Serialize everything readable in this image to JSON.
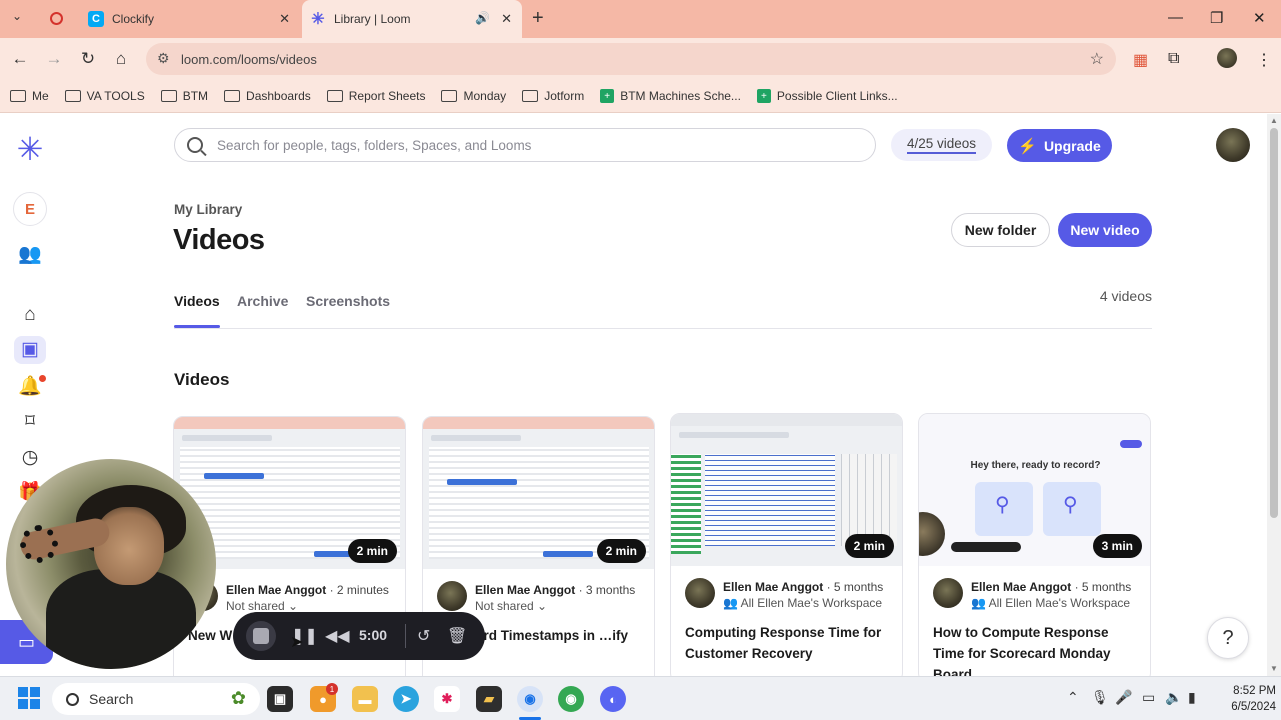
{
  "browser": {
    "tabs": [
      {
        "title": "Clockify",
        "active": false
      },
      {
        "title": "Library | Loom",
        "active": true
      }
    ],
    "url": "loom.com/looms/videos",
    "bookmarks": [
      "Me",
      "VA TOOLS",
      "BTM",
      "Dashboards",
      "Report Sheets",
      "Monday",
      "Jotform",
      "BTM Machines Sche...",
      "Possible Client Links..."
    ]
  },
  "sidebar": {
    "workspace_letter": "E"
  },
  "header": {
    "search_placeholder": "Search for people, tags, folders, Spaces, and Looms",
    "quota": "4/25 videos",
    "upgrade_label": "Upgrade"
  },
  "library": {
    "breadcrumb": "My Library",
    "title": "Videos",
    "new_folder": "New folder",
    "new_video": "New video",
    "tabs": [
      "Videos",
      "Archive",
      "Screenshots"
    ],
    "count": "4 videos",
    "section_title": "Videos"
  },
  "videos": [
    {
      "duration": "2 min",
      "author": "Ellen Mae Anggot",
      "age": "2 minutes",
      "sharing": "Not shared",
      "title": "New W… on the C…"
    },
    {
      "duration": "2 min",
      "author": "Ellen Mae Anggot",
      "age": "3 months",
      "sharing": "Not shared",
      "title": "…Record Timestamps in …ify"
    },
    {
      "duration": "2 min",
      "author": "Ellen Mae Anggot",
      "age": "5 months",
      "sharing": "All Ellen Mae's Workspace",
      "title": "Computing Response Time for Customer Recovery"
    },
    {
      "duration": "3 min",
      "author": "Ellen Mae Anggot",
      "age": "5 months",
      "sharing": "All Ellen Mae's Workspace",
      "title": "How to Compute Response Time for Scorecard Monday Board",
      "thumb_text": "Hey there, ready to record?"
    }
  ],
  "recorder": {
    "timer": "5:00"
  },
  "taskbar": {
    "search_label": "Search",
    "time": "8:52 PM",
    "date": "6/5/2024"
  },
  "colors": {
    "accent": "#565ae6",
    "chrome_frame": "#f5b8a6",
    "chrome_toolbar": "#fbe7df"
  }
}
